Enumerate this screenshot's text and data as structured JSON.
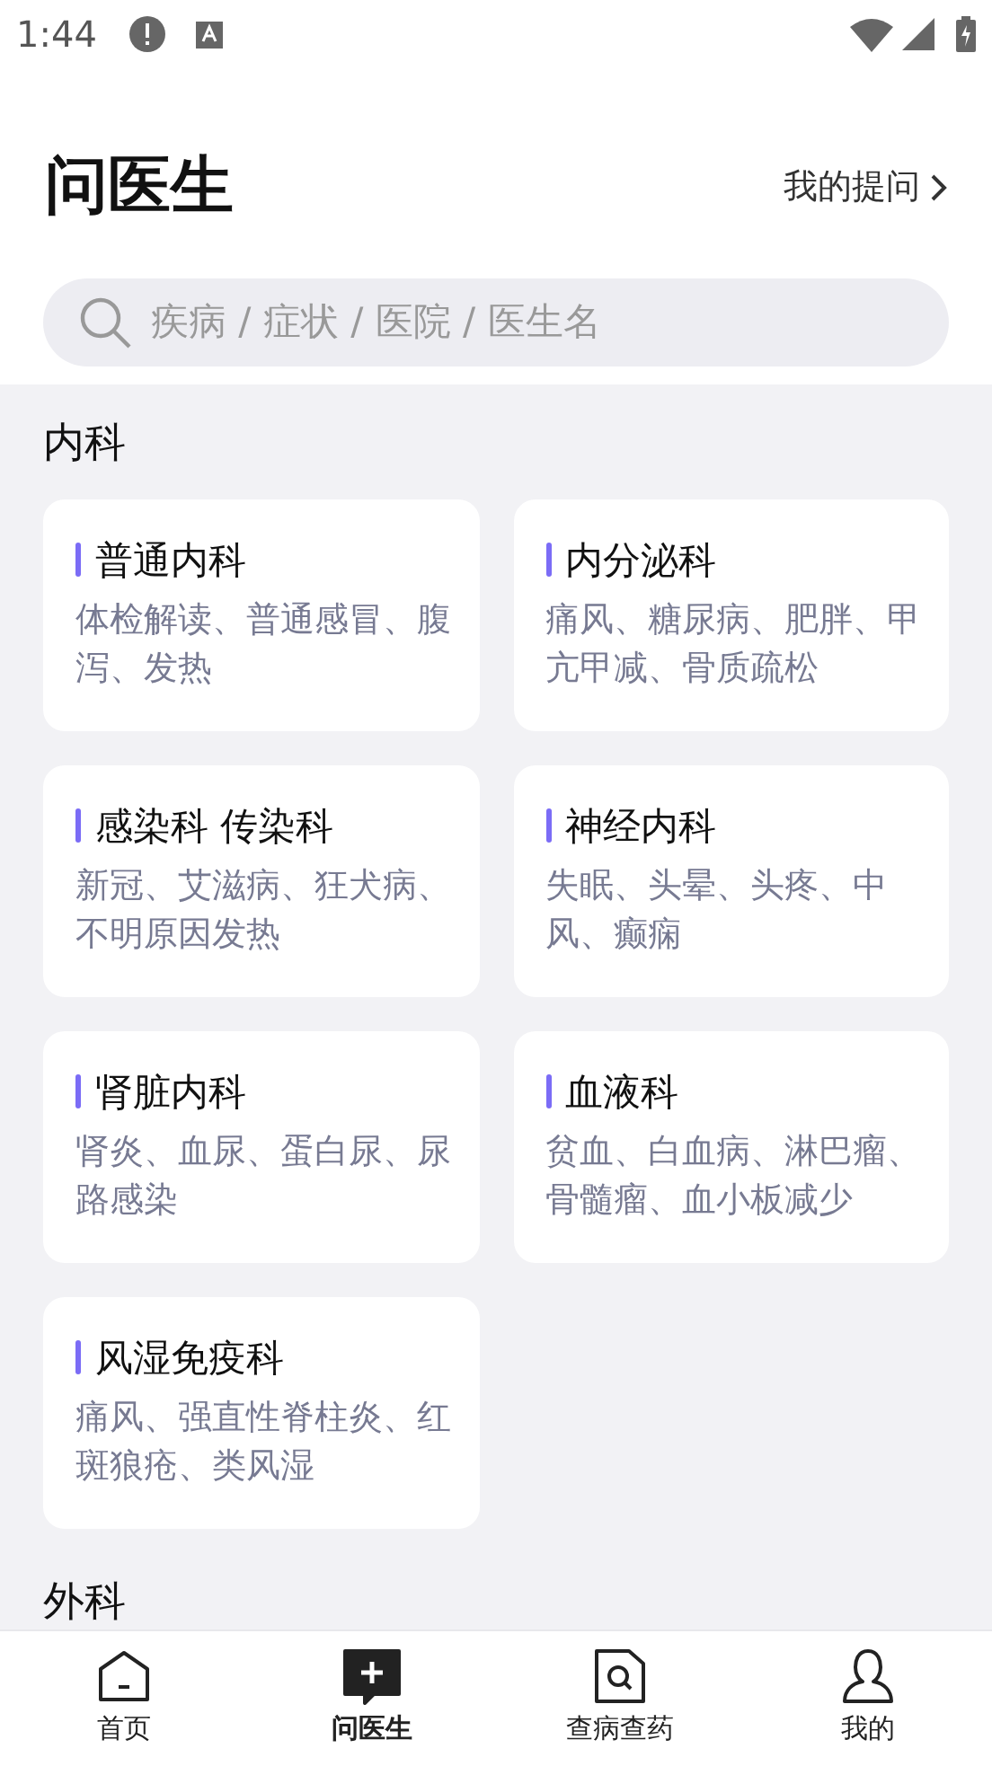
{
  "status_bar": {
    "time": "1:44"
  },
  "header": {
    "title": "问医生",
    "link": "我的提问"
  },
  "search": {
    "placeholder": "疾病 / 症状 / 医院 / 医生名"
  },
  "sections": [
    {
      "title": "内科",
      "departments": [
        {
          "name": "普通内科",
          "desc": "体检解读、普通感冒、腹泻、发热"
        },
        {
          "name": "内分泌科",
          "desc": "痛风、糖尿病、肥胖、甲亢甲减、骨质疏松"
        },
        {
          "name": "感染科 传染科",
          "desc": "新冠、艾滋病、狂犬病、不明原因发热"
        },
        {
          "name": "神经内科",
          "desc": "失眠、头晕、头疼、中风、癫痫"
        },
        {
          "name": "肾脏内科",
          "desc": "肾炎、血尿、蛋白尿、尿路感染"
        },
        {
          "name": "血液科",
          "desc": "贫血、白血病、淋巴瘤、骨髓瘤、血小板减少"
        },
        {
          "name": "风湿免疫科",
          "desc": "痛风、强直性脊柱炎、红斑狼疮、类风湿"
        }
      ]
    },
    {
      "title": "外科"
    }
  ],
  "bottom_nav": [
    {
      "label": "首页",
      "kind": "home",
      "selected": false
    },
    {
      "label": "问医生",
      "kind": "ask",
      "selected": true
    },
    {
      "label": "查病查药",
      "kind": "search",
      "selected": false
    },
    {
      "label": "我的",
      "kind": "profile",
      "selected": false
    }
  ]
}
